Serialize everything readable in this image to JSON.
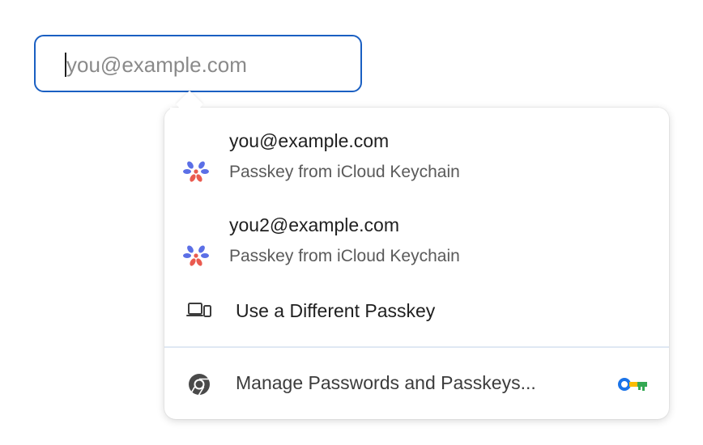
{
  "email_input": {
    "placeholder": "you@example.com"
  },
  "dropdown": {
    "accounts": [
      {
        "email": "you@example.com",
        "source": "Passkey from iCloud Keychain",
        "icon": "passkey-icon"
      },
      {
        "email": "you2@example.com",
        "source": "Passkey from iCloud Keychain",
        "icon": "passkey-icon"
      }
    ],
    "different_passkey": {
      "label": "Use a Different Passkey",
      "icon": "devices-icon"
    },
    "manage": {
      "label": "Manage Passwords and Passkeys...",
      "icon": "chrome-icon",
      "trailing_icon": "key-icon"
    }
  },
  "colors": {
    "focus_border": "#1a5fc2",
    "passkey_blue": "#5b6fe6",
    "passkey_red": "#ea5a4f",
    "key_blue": "#1a73e8",
    "key_yellow": "#fbbc04",
    "key_green": "#34a853"
  }
}
